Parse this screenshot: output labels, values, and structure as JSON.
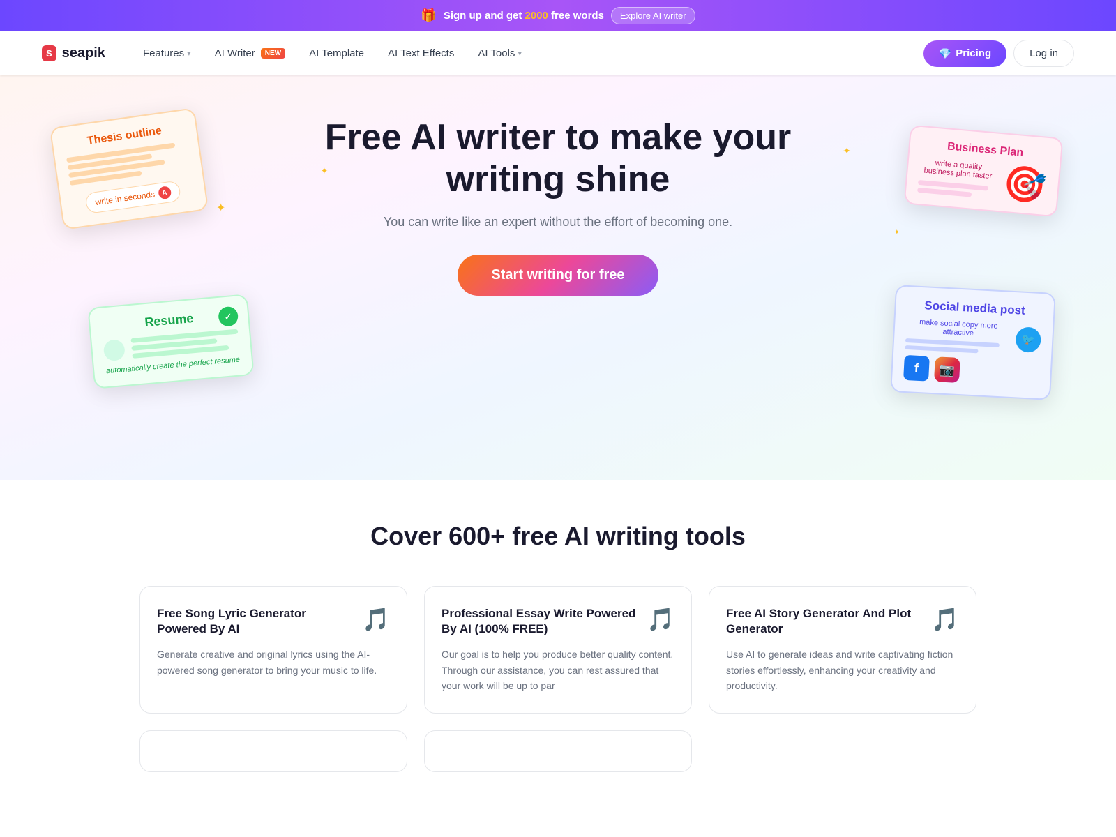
{
  "banner": {
    "gift_icon": "🎁",
    "text_before": "Sign up and get ",
    "highlight": "2000",
    "text_after": " free words",
    "explore_btn": "Explore AI writer"
  },
  "navbar": {
    "logo_text": "seapik",
    "logo_icon": "S",
    "links": [
      {
        "label": "Features",
        "has_chevron": true,
        "new": false
      },
      {
        "label": "AI Writer",
        "has_chevron": false,
        "new": true
      },
      {
        "label": "AI Template",
        "has_chevron": false,
        "new": false
      },
      {
        "label": "AI Text Effects",
        "has_chevron": false,
        "new": false
      },
      {
        "label": "AI Tools",
        "has_chevron": true,
        "new": false
      }
    ],
    "pricing_btn": "Pricing",
    "login_btn": "Log in"
  },
  "hero": {
    "title": "Free AI writer to make your writing shine",
    "subtitle": "You can write like an expert without the effort of becoming one.",
    "cta_btn": "Start writing for free",
    "cards": {
      "thesis": {
        "title": "Thesis outline",
        "btn_text": "write in seconds"
      },
      "business": {
        "title": "Business Plan",
        "desc": "write a quality business plan faster"
      },
      "resume": {
        "title": "Resume",
        "desc": "automatically create the perfect resume"
      },
      "social": {
        "title": "Social media post",
        "desc": "make social copy more attractive"
      }
    }
  },
  "tools": {
    "title": "Cover 600+ free AI writing tools",
    "cards": [
      {
        "title": "Free Song Lyric Generator Powered By AI",
        "desc": "Generate creative and original lyrics using the AI-powered song generator to bring your music to life.",
        "icon": "🎵"
      },
      {
        "title": "Professional Essay Write Powered By AI (100% FREE)",
        "desc": "Our goal is to help you produce better quality content. Through our assistance, you can rest assured that your work will be up to par",
        "icon": "🎵"
      },
      {
        "title": "Free AI Story Generator And Plot Generator",
        "desc": "Use AI to generate ideas and write captivating fiction stories effortlessly, enhancing your creativity and productivity.",
        "icon": "🎵"
      }
    ]
  }
}
